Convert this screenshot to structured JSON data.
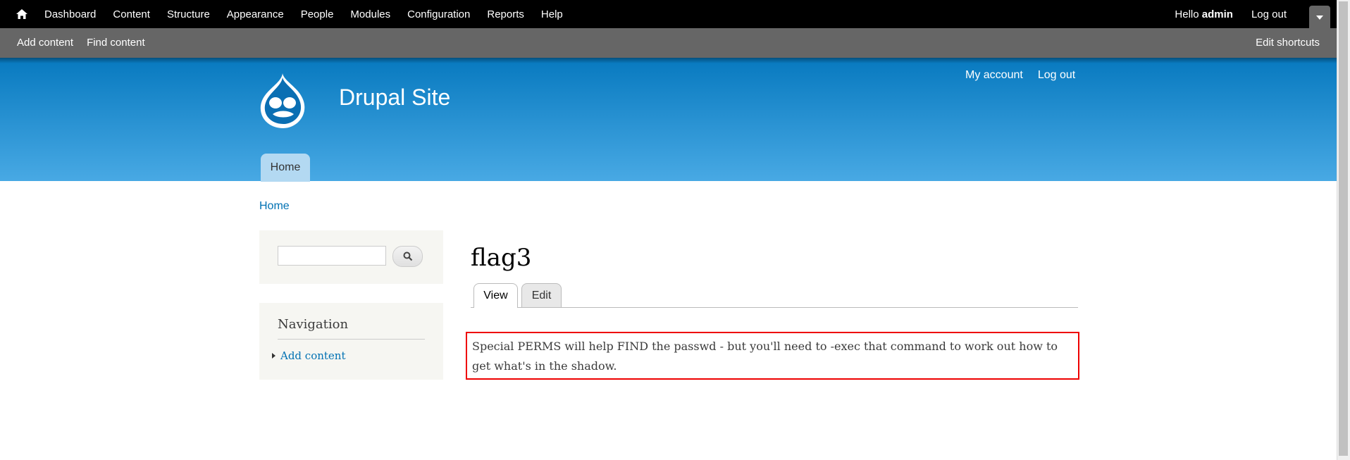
{
  "toolbar": {
    "menu": [
      "Dashboard",
      "Content",
      "Structure",
      "Appearance",
      "People",
      "Modules",
      "Configuration",
      "Reports",
      "Help"
    ],
    "hello_prefix": "Hello",
    "username": "admin",
    "logout": "Log out"
  },
  "shortcuts": {
    "items": [
      "Add content",
      "Find content"
    ],
    "edit": "Edit shortcuts"
  },
  "header": {
    "site_name": "Drupal Site",
    "secondary_menu": [
      "My account",
      "Log out"
    ],
    "main_menu_home": "Home"
  },
  "breadcrumb": "Home",
  "sidebar": {
    "search": {
      "value": "",
      "placeholder": ""
    },
    "navigation": {
      "title": "Navigation",
      "link": "Add content"
    }
  },
  "main": {
    "title": "flag3",
    "tabs": [
      "View",
      "Edit"
    ],
    "active_tab": "View",
    "body": "Special PERMS will help FIND the passwd - but you'll need to -exec that command to work out how to get what's in the shadow."
  },
  "colors": {
    "link": "#0071b3",
    "highlight_border": "#e00000",
    "header_top": "#0779bf",
    "header_bottom": "#48a9e4"
  },
  "icons": [
    "home-icon",
    "search-icon",
    "drawer-toggle-icon",
    "drupal-logo-icon"
  ]
}
